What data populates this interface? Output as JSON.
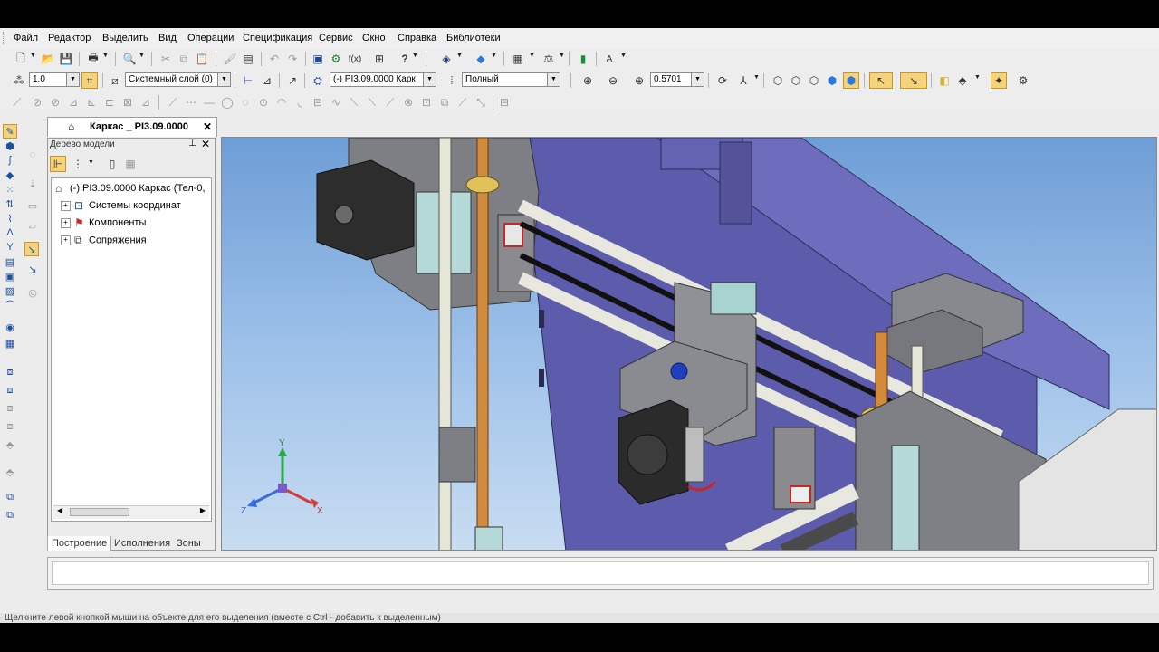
{
  "menu": [
    "Файл",
    "Редактор",
    "Выделить",
    "Вид",
    "Операции",
    "Спецификация",
    "Сервис",
    "Окно",
    "Справка",
    "Библиотеки"
  ],
  "toolbar1": {
    "scale_value": "1.0",
    "layer_value": "Системный слой (0)",
    "model_value": "(-) РІ3.09.0000 Карк",
    "view_mode_value": "Полный",
    "zoom_value": "0.5701"
  },
  "document_tab": {
    "title": "Каркас _ РІ3.09.0000"
  },
  "tree_panel": {
    "title": "Дерево модели",
    "root": "(-) РІ3.09.0000 Каркас (Тел-0,",
    "items": [
      "Системы координат",
      "Компоненты",
      "Сопряжения"
    ],
    "tabs": [
      "Построение",
      "Исполнения",
      "Зоны"
    ]
  },
  "axes": {
    "x": "X",
    "y": "Y",
    "z": "Z"
  },
  "status": {
    "hint": "Щелкните левой кнопкой мыши на объекте для его выделения (вместе с Ctrl - добавить к выделенным)"
  }
}
